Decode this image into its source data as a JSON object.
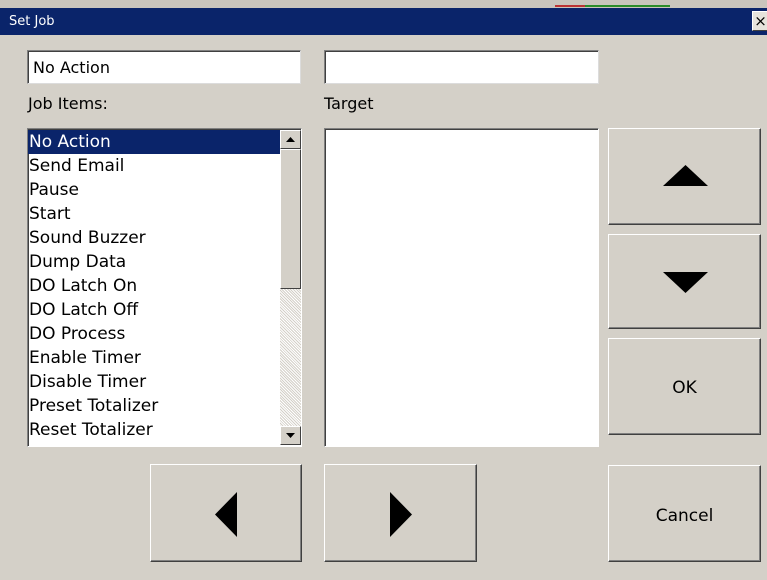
{
  "window": {
    "title": "Set Job",
    "close_glyph": "×"
  },
  "fields": {
    "action_value": "No Action",
    "target_value": ""
  },
  "labels": {
    "job_items": "Job Items:",
    "target": "Target"
  },
  "job_items": [
    "No Action",
    "Send Email",
    "Pause",
    "Start",
    "Sound Buzzer",
    "Dump Data",
    "DO Latch On",
    "DO Latch Off",
    "DO Process",
    "Enable Timer",
    "Disable Timer",
    "Preset Totalizer",
    "Reset Totalizer"
  ],
  "selected_index": 0,
  "target_items": [],
  "buttons": {
    "up_icon": "up-arrow-icon",
    "down_icon": "down-arrow-icon",
    "ok": "OK",
    "cancel": "Cancel",
    "left_icon": "left-arrow-icon",
    "right_icon": "right-arrow-icon"
  }
}
